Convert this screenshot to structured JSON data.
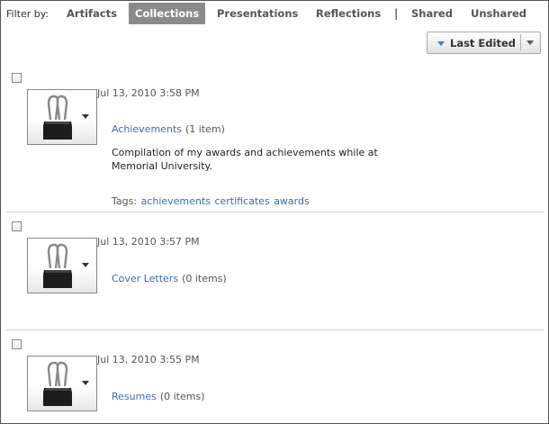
{
  "filter": {
    "label": "Filter by:",
    "options": [
      "Artifacts",
      "Collections",
      "Presentations",
      "Reflections",
      "Shared",
      "Unshared"
    ],
    "active": "Collections",
    "separator": "|"
  },
  "sort": {
    "label": "Last Edited"
  },
  "items": [
    {
      "date": "Jul 13, 2010 3:58 PM",
      "title": "Achievements",
      "count": "(1 item)",
      "description": "Compilation of my awards and achievements while at Memorial University.",
      "tags_label": "Tags:",
      "tags": [
        "achievements",
        "certificates",
        "awards"
      ]
    },
    {
      "date": "Jul 13, 2010 3:57 PM",
      "title": "Cover Letters",
      "count": "(0 items)"
    },
    {
      "date": "Jul 13, 2010 3:55 PM",
      "title": "Resumes",
      "count": "(0 items)"
    }
  ],
  "icons": {
    "thumbnail": "binder-clip-icon",
    "sort_direction": "triangle-down-icon",
    "menu": "chevron-down-icon"
  },
  "colors": {
    "link": "#3b6bb0",
    "active_filter_bg": "#8a8a8a",
    "sort_arrow": "#3a7fc4"
  }
}
